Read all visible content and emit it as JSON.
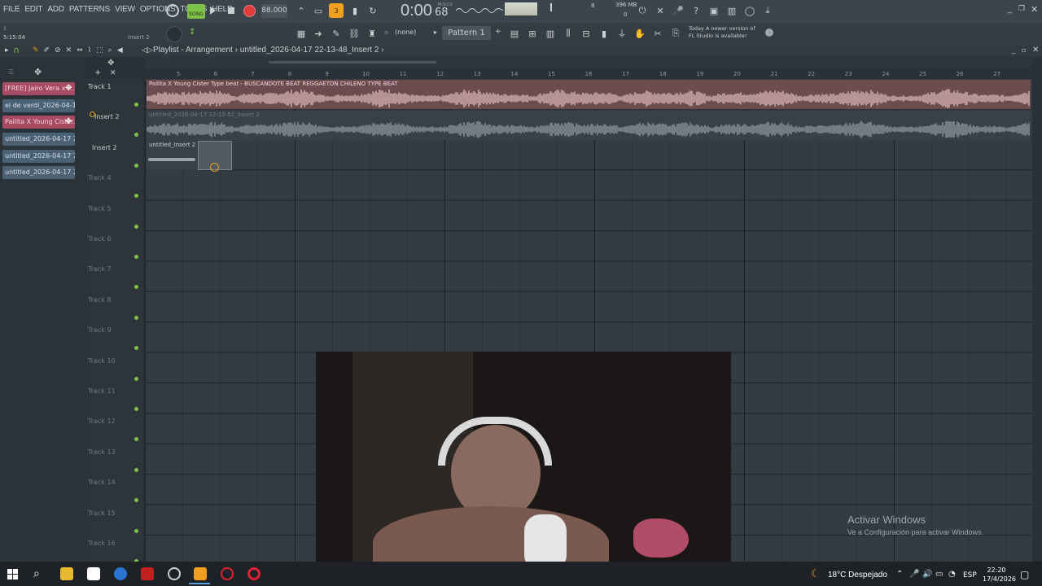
{
  "menu": [
    "FILE",
    "EDIT",
    "ADD",
    "PATTERNS",
    "VIEW",
    "OPTIONS",
    "TOOLS",
    "HELP"
  ],
  "song_mode": "SONG",
  "tempo": "88.000",
  "time_display": "0:00",
  "time_frac": "68",
  "time_label": "M:S:CS",
  "cpu_label": "396 MB",
  "cpu_num": "8",
  "cpu_zero": "0",
  "time_small": "5:15:04",
  "hint_target": "Insert 2",
  "pattern_name": "Pattern 1",
  "snap": "(none)",
  "news_line1": "Today  A newer version of",
  "news_line2": "FL Studio is available!",
  "breadcrumb": {
    "playlist": "Playlist - Arrangement",
    "file": "untitled_2026-04-17 22-13-48_Insert 2"
  },
  "pattern_list": [
    {
      "label": "[FREE] Jairo Vera x P...",
      "style": "pink"
    },
    {
      "label": "el de verdi_2026-04-13...",
      "style": "blue"
    },
    {
      "label": "Pailita X Young Cister...",
      "style": "pink"
    },
    {
      "label": "untitled_2026-04-17 22-...",
      "style": "blue"
    },
    {
      "label": "untitled_2026-04-17 22-...",
      "style": "blue"
    },
    {
      "label": "untitled_2026-04-17 22-...",
      "style": "blue"
    }
  ],
  "ruler": [
    "5",
    "6",
    "7",
    "8",
    "9",
    "10",
    "11",
    "12",
    "13",
    "14",
    "15",
    "16",
    "17",
    "18",
    "19",
    "20",
    "21",
    "22",
    "23",
    "24",
    "25",
    "26",
    "27"
  ],
  "tracks": [
    "Track 1",
    "Insert 2",
    "Insert 2",
    "Track 4",
    "Track 5",
    "Track 6",
    "Track 7",
    "Track 8",
    "Track 9",
    "Track 10",
    "Track 11",
    "Track 12",
    "Track 13",
    "Track 14",
    "Track 15",
    "Track 16"
  ],
  "clips": {
    "clip1": "Pailita X Young Cister Type beat - BUSCANDOTE  BEAT REGGAETON CHILENO TYPE BEAT",
    "clip2": "untitled_2026-04-17 22-13-52_Insert 2",
    "clip3": "untitled_Insert 2"
  },
  "watermark": {
    "title": "Activar Windows",
    "sub": "Ve a Configuración para activar Windows."
  },
  "taskbar": {
    "weather": "18°C  Despejado",
    "lang": "ESP",
    "time": "22:20",
    "date": "17/4/2026"
  },
  "colors": {
    "accent": "#f0a020",
    "record": "#e23b3b",
    "waveform_pink": "#e8c3c6",
    "waveform_gray": "#9aa3a8"
  }
}
